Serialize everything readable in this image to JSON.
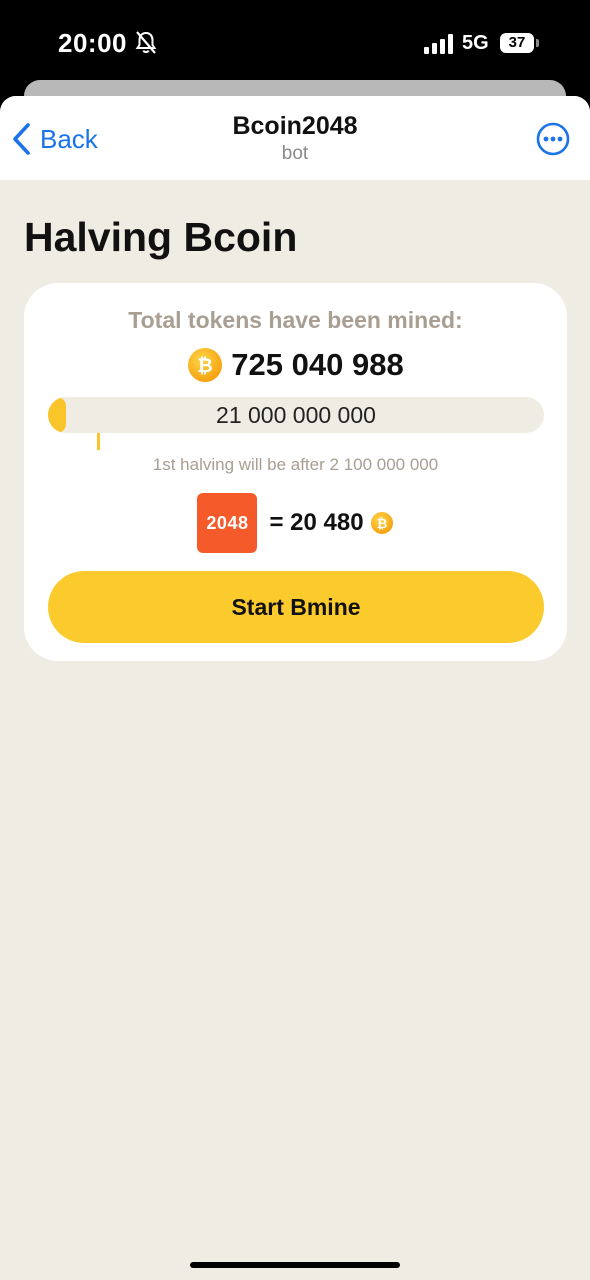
{
  "status_bar": {
    "time": "20:00",
    "network": "5G",
    "battery": "37",
    "icons": [
      "bell-slash-icon",
      "signal-icon",
      "battery-icon"
    ]
  },
  "nav": {
    "back_label": "Back",
    "title": "Bcoin2048",
    "subtitle": "bot",
    "icons": [
      "chevron-left-icon",
      "more-icon"
    ]
  },
  "page": {
    "title": "Halving Bcoin"
  },
  "card": {
    "mined_label": "Total tokens have been mined:",
    "mined_value": "725 040 988",
    "supply_total": "21 000 000 000",
    "mined_fraction": 0.0345,
    "halving_note": "1st halving will be after 2 100 000 000",
    "tile_label": "2048",
    "equals_text": "= 20 480",
    "start_button": "Start Bmine",
    "icons": [
      "bcoin-icon"
    ]
  },
  "colors": {
    "accent_yellow": "#fbcb2e",
    "tile_orange": "#f55a2a",
    "link_blue": "#1a73e8",
    "background": "#efede3"
  }
}
